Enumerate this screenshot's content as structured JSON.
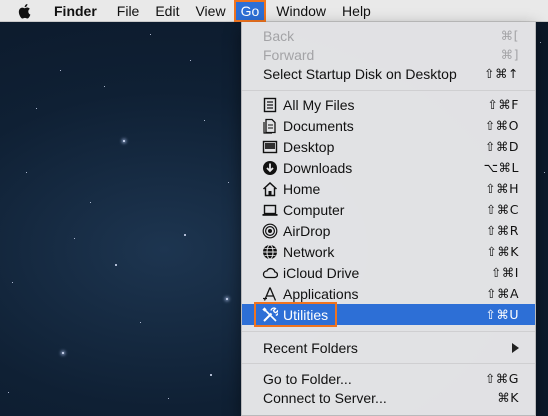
{
  "menubar": {
    "items": [
      "Finder",
      "File",
      "Edit",
      "View",
      "Go",
      "Window",
      "Help"
    ],
    "active": "Go"
  },
  "menu": {
    "back": {
      "label": "Back",
      "shortcut": "⌘["
    },
    "forward": {
      "label": "Forward",
      "shortcut": "⌘]"
    },
    "startup": {
      "label": "Select Startup Disk on Desktop",
      "shortcut": "⇧⌘↑"
    },
    "places": [
      {
        "label": "All My Files",
        "shortcut": "⇧⌘F",
        "icon": "all-my-files-icon"
      },
      {
        "label": "Documents",
        "shortcut": "⇧⌘O",
        "icon": "documents-icon"
      },
      {
        "label": "Desktop",
        "shortcut": "⇧⌘D",
        "icon": "desktop-icon"
      },
      {
        "label": "Downloads",
        "shortcut": "⌥⌘L",
        "icon": "downloads-icon"
      },
      {
        "label": "Home",
        "shortcut": "⇧⌘H",
        "icon": "home-icon"
      },
      {
        "label": "Computer",
        "shortcut": "⇧⌘C",
        "icon": "computer-icon"
      },
      {
        "label": "AirDrop",
        "shortcut": "⇧⌘R",
        "icon": "airdrop-icon"
      },
      {
        "label": "Network",
        "shortcut": "⇧⌘K",
        "icon": "network-icon"
      },
      {
        "label": "iCloud Drive",
        "shortcut": "⇧⌘I",
        "icon": "icloud-icon"
      },
      {
        "label": "Applications",
        "shortcut": "⇧⌘A",
        "icon": "applications-icon"
      },
      {
        "label": "Utilities",
        "shortcut": "⇧⌘U",
        "icon": "utilities-icon"
      }
    ],
    "recent": {
      "label": "Recent Folders"
    },
    "goto_folder": {
      "label": "Go to Folder...",
      "shortcut": "⇧⌘G"
    },
    "connect_server": {
      "label": "Connect to Server...",
      "shortcut": "⌘K"
    }
  },
  "colors": {
    "highlight": "#2d6fd6",
    "annotation": "#f0741f"
  }
}
